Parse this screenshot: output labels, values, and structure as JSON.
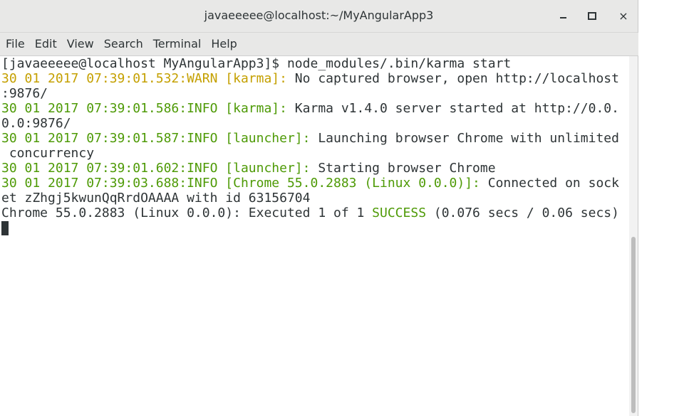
{
  "window": {
    "title": "javaeeeee@localhost:~/MyAngularApp3",
    "controls": {
      "minimize": "minimize-icon",
      "maximize": "maximize-icon",
      "close": "×"
    }
  },
  "menu": {
    "file": "File",
    "edit": "Edit",
    "view": "View",
    "search": "Search",
    "terminal": "Terminal",
    "help": "Help"
  },
  "colors": {
    "info": "#4e9a06",
    "warn": "#c4a000",
    "text": "#2e3436"
  },
  "terminal": {
    "l1": "[javaeeeee@localhost MyAngularApp3]$ node_modules/.bin/karma start",
    "l2a": "30 01 2017 07:39:01.532:WARN [karma]:",
    "l2b": " No captured browser, open http://localhost",
    "l3": ":9876/",
    "l4a": "30 01 2017 07:39:01.586:INFO [karma]:",
    "l4b": " Karma v1.4.0 server started at http://0.0.",
    "l5": "0.0:9876/",
    "l6a": "30 01 2017 07:39:01.587:INFO [launcher]:",
    "l6b": " Launching browser Chrome with unlimited",
    "l7": " concurrency",
    "l8a": "30 01 2017 07:39:01.602:INFO [launcher]:",
    "l8b": " Starting browser Chrome",
    "l9a": "30 01 2017 07:39:03.688:INFO [Chrome 55.0.2883 (Linux 0.0.0)]:",
    "l9b": " Connected on sock",
    "l10": "et zZhgj5kwunQqRrdOAAAA with id 63156704",
    "l11a": "Chrome 55.0.2883 (Linux 0.0.0): Executed 1 of 1 ",
    "l11b": "SUCCESS",
    "l11c": " (0.076 secs / 0.06 secs)"
  }
}
